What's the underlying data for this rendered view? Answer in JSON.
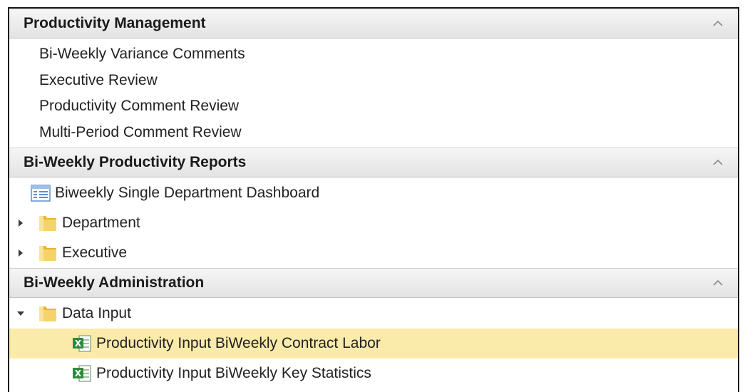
{
  "sections": [
    {
      "title": "Productivity Management",
      "items": [
        "Bi-Weekly Variance Comments",
        "Executive Review",
        "Productivity Comment Review",
        "Multi-Period Comment Review"
      ]
    },
    {
      "title": "Bi-Weekly Productivity Reports",
      "nodes": [
        {
          "label": "Biweekly Single Department Dashboard",
          "icon": "dashboard-icon"
        },
        {
          "label": "Department",
          "icon": "folder-icon",
          "state": "collapsed"
        },
        {
          "label": "Executive",
          "icon": "folder-icon",
          "state": "collapsed"
        }
      ]
    },
    {
      "title": "Bi-Weekly Administration",
      "nodes": [
        {
          "label": "Data Input",
          "icon": "folder-icon",
          "state": "expanded"
        },
        {
          "label": "Productivity Input BiWeekly Contract Labor",
          "icon": "excel-icon",
          "selected": true
        },
        {
          "label": "Productivity Input BiWeekly Key Statistics",
          "icon": "excel-icon"
        }
      ]
    }
  ],
  "colors": {
    "selected_row": "#fbebab",
    "header_bg": "#e8e8e8",
    "folder": "#e8b430"
  }
}
